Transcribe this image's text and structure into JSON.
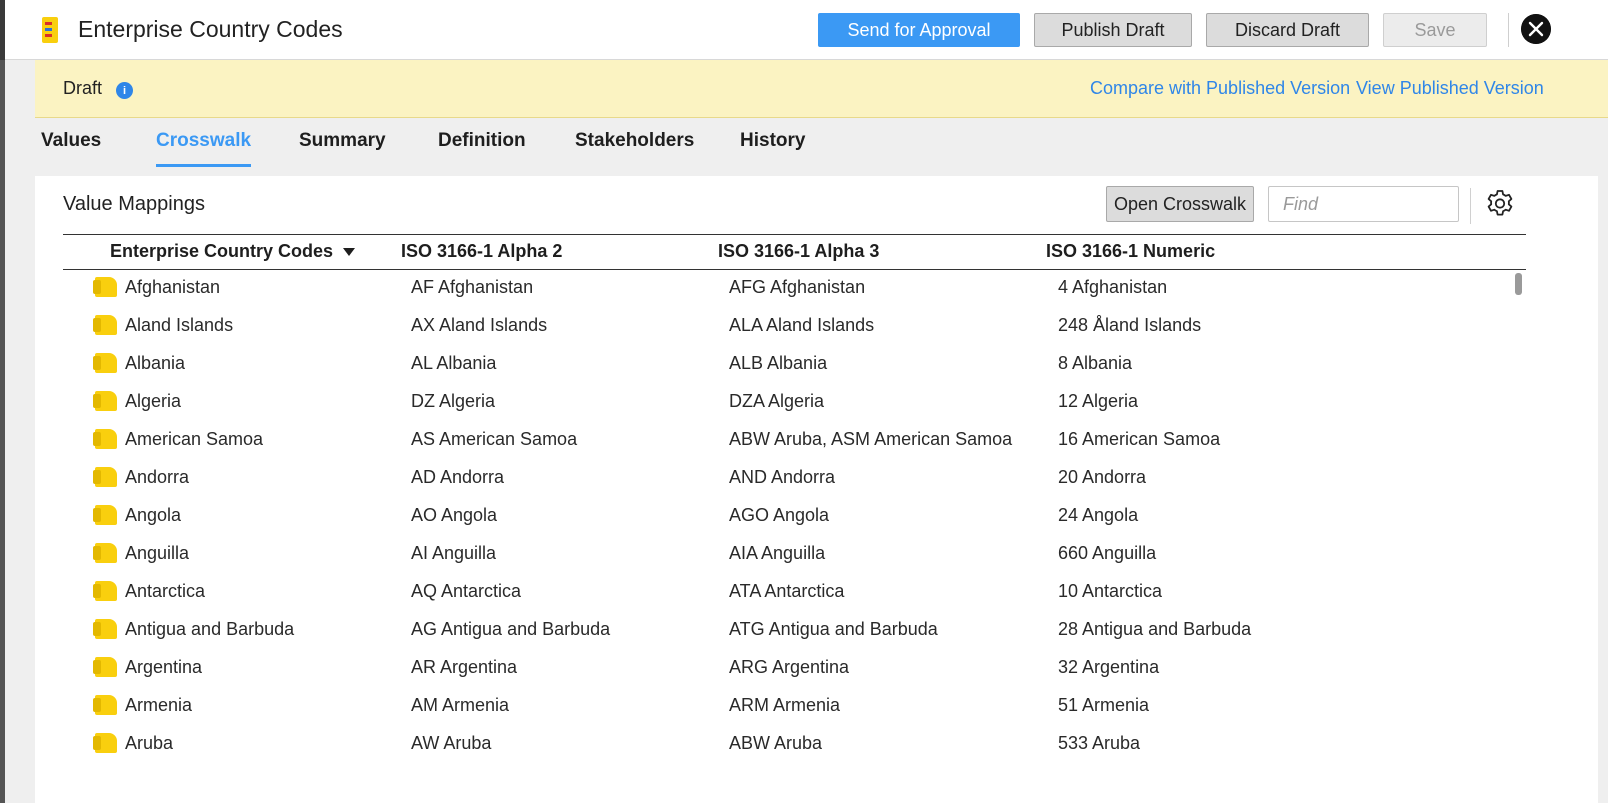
{
  "header": {
    "title": "Enterprise Country Codes",
    "buttons": {
      "send_for_approval": "Send for Approval",
      "publish_draft": "Publish Draft",
      "discard_draft": "Discard Draft",
      "save": "Save"
    }
  },
  "banner": {
    "status": "Draft",
    "info_symbol": "i",
    "compare_link": "Compare with Published Version",
    "view_link": "View Published Version"
  },
  "tabs": [
    {
      "label": "Values"
    },
    {
      "label": "Crosswalk"
    },
    {
      "label": "Summary"
    },
    {
      "label": "Definition"
    },
    {
      "label": "Stakeholders"
    },
    {
      "label": "History"
    }
  ],
  "active_tab": "Crosswalk",
  "panel": {
    "title": "Value Mappings",
    "open_crosswalk_label": "Open Crosswalk",
    "find_placeholder": "Find"
  },
  "table": {
    "columns": [
      "Enterprise Country Codes",
      "ISO 3166-1 Alpha 2",
      "ISO 3166-1 Alpha 3",
      "ISO 3166-1 Numeric"
    ],
    "sorted_column": "Enterprise Country Codes",
    "sort_direction": "descending-indicator",
    "rows": [
      {
        "enterprise": "Afghanistan",
        "alpha2": "AF Afghanistan",
        "alpha3": "AFG Afghanistan",
        "numeric": "4 Afghanistan"
      },
      {
        "enterprise": "Aland Islands",
        "alpha2": "AX Aland Islands",
        "alpha3": "ALA Aland Islands",
        "numeric": "248 Åland Islands"
      },
      {
        "enterprise": "Albania",
        "alpha2": "AL Albania",
        "alpha3": "ALB Albania",
        "numeric": "8 Albania"
      },
      {
        "enterprise": "Algeria",
        "alpha2": "DZ Algeria",
        "alpha3": "DZA Algeria",
        "numeric": "12 Algeria"
      },
      {
        "enterprise": "American Samoa",
        "alpha2": "AS American Samoa",
        "alpha3": "ABW Aruba, ASM American Samoa",
        "numeric": "16 American Samoa"
      },
      {
        "enterprise": "Andorra",
        "alpha2": "AD Andorra",
        "alpha3": "AND Andorra",
        "numeric": "20 Andorra"
      },
      {
        "enterprise": "Angola",
        "alpha2": "AO Angola",
        "alpha3": "AGO Angola",
        "numeric": "24 Angola"
      },
      {
        "enterprise": "Anguilla",
        "alpha2": "AI Anguilla",
        "alpha3": "AIA Anguilla",
        "numeric": "660 Anguilla"
      },
      {
        "enterprise": "Antarctica",
        "alpha2": "AQ Antarctica",
        "alpha3": "ATA Antarctica",
        "numeric": "10 Antarctica"
      },
      {
        "enterprise": "Antigua and Barbuda",
        "alpha2": "AG Antigua and Barbuda",
        "alpha3": "ATG Antigua and Barbuda",
        "numeric": "28 Antigua and Barbuda"
      },
      {
        "enterprise": "Argentina",
        "alpha2": "AR Argentina",
        "alpha3": "ARG Argentina",
        "numeric": "32 Argentina"
      },
      {
        "enterprise": "Armenia",
        "alpha2": "AM Armenia",
        "alpha3": "ARM Armenia",
        "numeric": "51 Armenia"
      },
      {
        "enterprise": "Aruba",
        "alpha2": "AW Aruba",
        "alpha3": "ABW Aruba",
        "numeric": "533 Aruba"
      }
    ]
  },
  "colors": {
    "accent": "#3b99f4",
    "banner_bg": "#fbf3c2",
    "folder": "#f9cf0e"
  },
  "icons": {
    "app": "app-logo-icon",
    "close": "close-icon",
    "info": "info-icon",
    "settings": "gear-icon",
    "row": "folder-icon",
    "sort": "sort-down-icon"
  }
}
